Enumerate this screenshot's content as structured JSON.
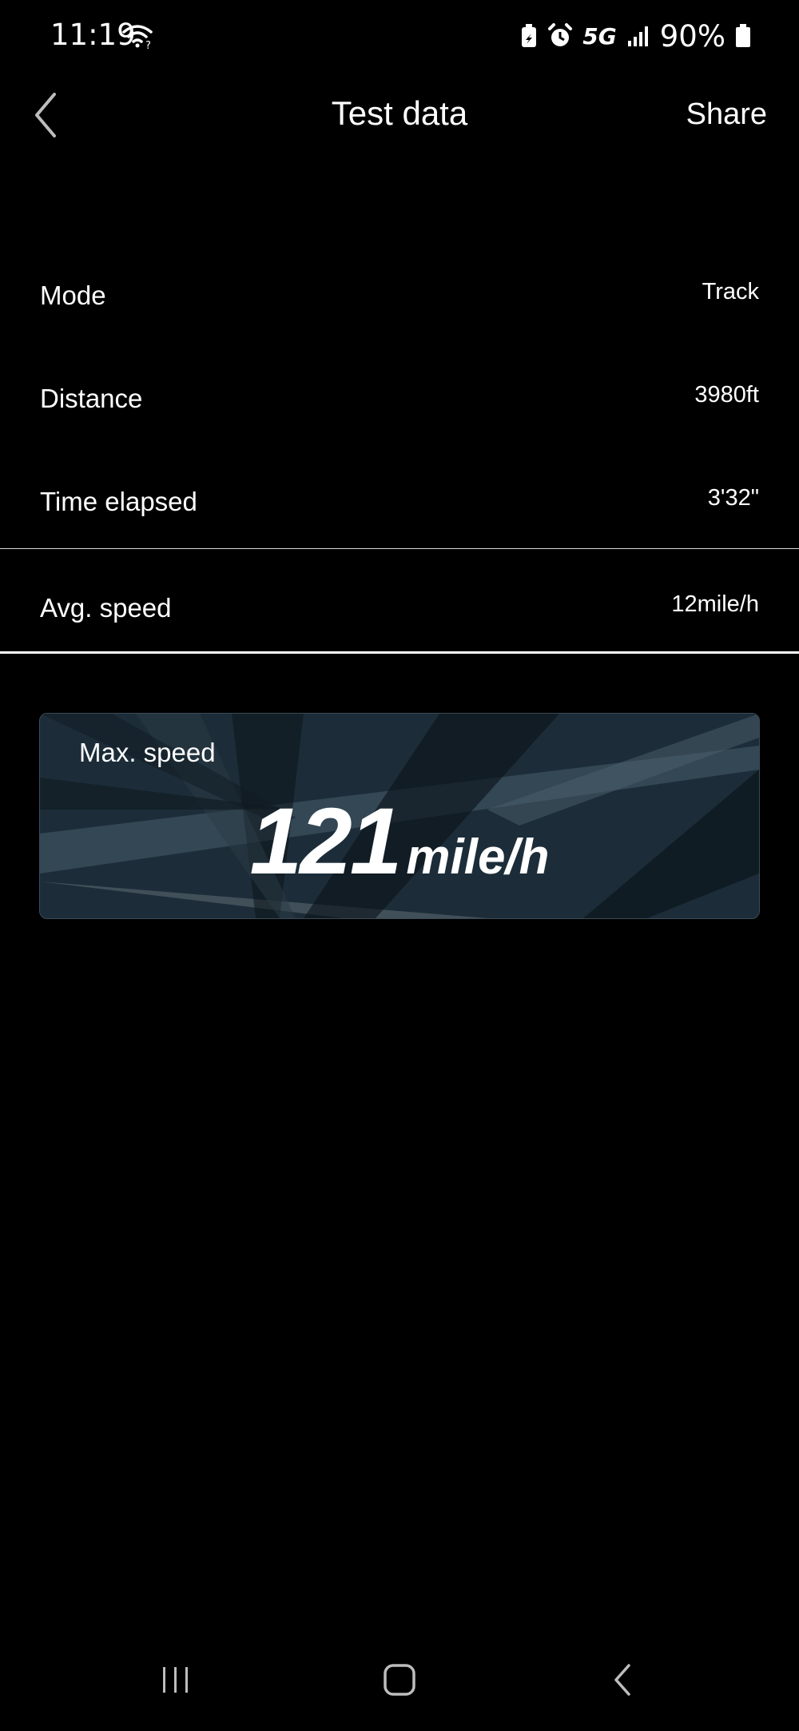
{
  "status_bar": {
    "time": "11:19",
    "network": "5G",
    "battery_percent": "90%"
  },
  "header": {
    "title": "Test data",
    "share_label": "Share"
  },
  "rows": [
    {
      "label": "Mode",
      "value": "Track"
    },
    {
      "label": "Distance",
      "value": "3980ft"
    },
    {
      "label": "Time elapsed",
      "value": "3'32\""
    },
    {
      "label": "Avg. speed",
      "value": "12mile/h"
    }
  ],
  "max_speed": {
    "label": "Max. speed",
    "value": "121",
    "unit": "mile/h"
  },
  "icons": {
    "back": "chevron-left-icon",
    "wifi": "wifi-icon",
    "alarm": "alarm-icon",
    "signal": "signal-icon",
    "battery": "battery-icon"
  },
  "colors": {
    "background": "#000000",
    "card": "#1b2b36",
    "text": "#ffffff"
  }
}
